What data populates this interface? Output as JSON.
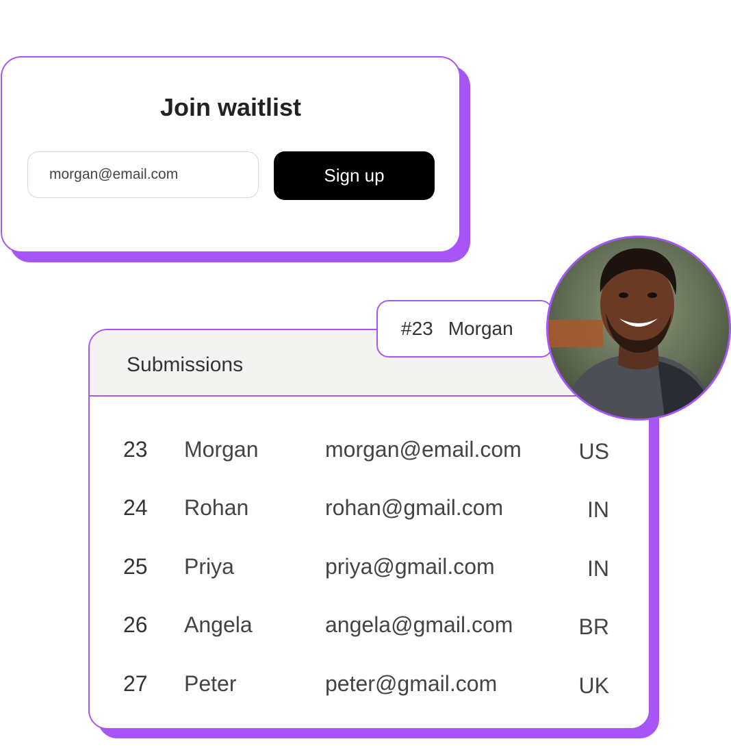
{
  "waitlist": {
    "title": "Join waitlist",
    "email_value": "morgan@email.com",
    "signup_label": "Sign up"
  },
  "tag": {
    "number": "#23",
    "name": "Morgan"
  },
  "submissions": {
    "title": "Submissions",
    "rows": [
      {
        "num": "23",
        "name": "Morgan",
        "email": "morgan@email.com",
        "country": "US"
      },
      {
        "num": "24",
        "name": "Rohan",
        "email": "rohan@gmail.com",
        "country": "IN"
      },
      {
        "num": "25",
        "name": "Priya",
        "email": "priya@gmail.com",
        "country": "IN"
      },
      {
        "num": "26",
        "name": "Angela",
        "email": "angela@gmail.com",
        "country": "BR"
      },
      {
        "num": "27",
        "name": "Peter",
        "email": "peter@gmail.com",
        "country": "UK"
      }
    ]
  },
  "colors": {
    "accent": "#a855f7",
    "button_bg": "#000000",
    "header_bg": "#f3f4f1"
  },
  "avatar": {
    "icon": "user-photo-avatar"
  }
}
